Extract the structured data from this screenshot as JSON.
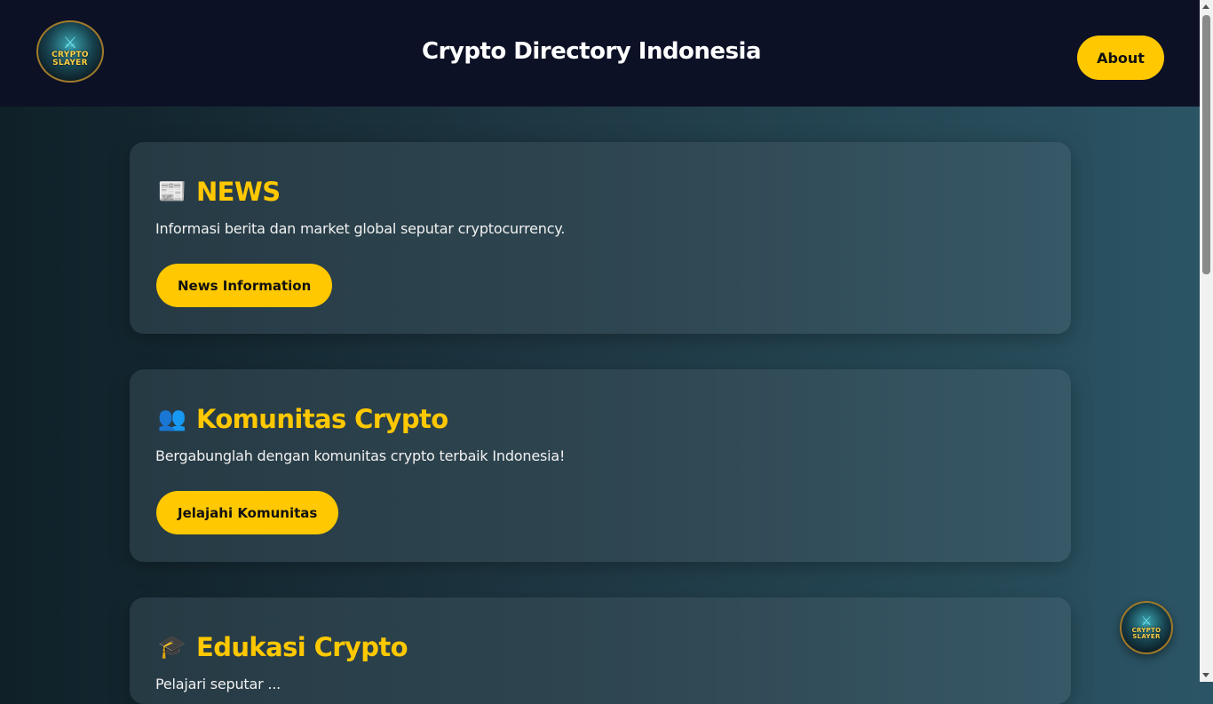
{
  "header": {
    "title": "Crypto Directory Indonesia",
    "about_label": "About",
    "logo_text": [
      "CRYPTO",
      "SLAYER"
    ]
  },
  "cards": [
    {
      "icon": "newspaper-icon",
      "icon_glyph": "📰",
      "title": "NEWS",
      "description": "Informasi berita dan market global seputar cryptocurrency.",
      "button_label": "News Information"
    },
    {
      "icon": "people-icon",
      "icon_glyph": "👥",
      "title": "Komunitas Crypto",
      "description": "Bergabunglah dengan komunitas crypto terbaik Indonesia!",
      "button_label": "Jelajahi Komunitas"
    },
    {
      "icon": "graduation-cap-icon",
      "icon_glyph": "🎓",
      "title": "Edukasi Crypto",
      "description": "Pelajari seputar ..."
    }
  ],
  "floating_logo_text": [
    "CRYPTO",
    "SLAYER"
  ],
  "colors": {
    "accent": "#ffc800",
    "header_bg": "#0d1126",
    "card_bg": "#2f4752"
  }
}
